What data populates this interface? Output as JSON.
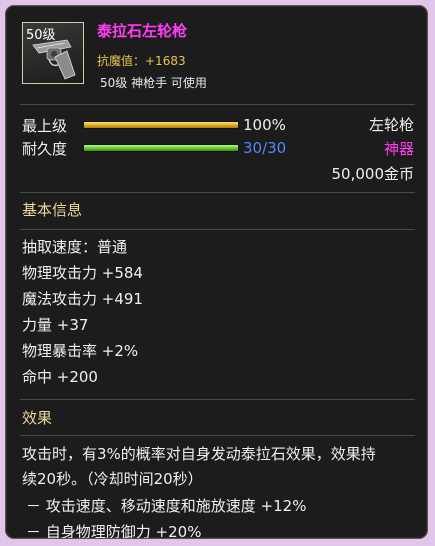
{
  "item": {
    "level_badge": "50级",
    "icon": "revolver-icon",
    "name": "泰拉石左轮枪",
    "anti_magic": "抗魔值：+1683",
    "requirement": "50级 神枪手 可使用"
  },
  "bars": {
    "grade_label": "最上级",
    "grade_value": "100%",
    "grade_fraction": 1.0,
    "durability_label": "耐久度",
    "durability_value": "30/30",
    "durability_fraction": 1.0
  },
  "meta": {
    "weapon_type": "左轮枪",
    "rarity": "神器",
    "price": "50,000金币"
  },
  "basic": {
    "title": "基本信息",
    "stats": [
      "抽取速度：普通",
      "物理攻击力 +584",
      "魔法攻击力 +491",
      "力量 +37",
      "物理暴击率 +2%",
      "命中 +200"
    ]
  },
  "effect": {
    "title": "效果",
    "lines": [
      "攻击时，有3%的概率对自身发动泰拉石效果，效果持",
      "续20秒。（冷却时间20秒）",
      "－ 攻击速度、移动速度和施放速度 +12%",
      "－ 自身物理防御力 +20%"
    ]
  },
  "colors": {
    "name": "#ff3df5",
    "anti_magic": "#e8c250",
    "durability_value": "#4f87ff",
    "section_title": "#ebd79a",
    "background": "#1c1c1c",
    "frame": "#e2c6ea"
  }
}
